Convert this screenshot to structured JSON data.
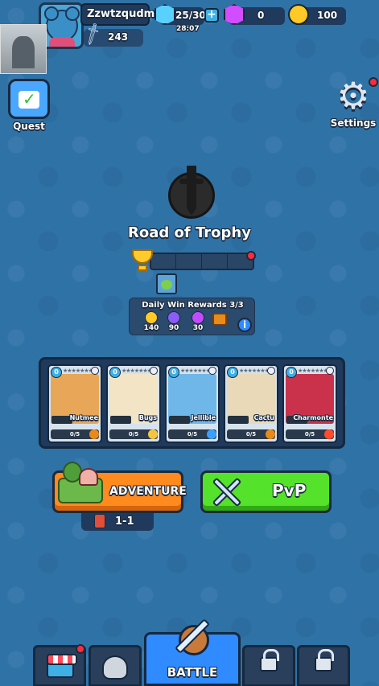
{
  "player": {
    "name": "Zzwtzqudmi",
    "power": "243"
  },
  "resources": {
    "energy": "25/30",
    "energy_timer": "28:07",
    "gems": "0",
    "coins": "100"
  },
  "side_buttons": {
    "quest_label": "Quest",
    "settings_label": "Settings"
  },
  "trophy_road": {
    "title": "Road of Trophy"
  },
  "daily_rewards": {
    "title": "Daily Win Rewards 3/3",
    "coins": "140",
    "hex": "90",
    "stars": "30"
  },
  "deck": {
    "cards": [
      {
        "name": "Nutmee",
        "level": "0",
        "progress": "0/5"
      },
      {
        "name": "Bugs",
        "level": "0",
        "progress": "0/5"
      },
      {
        "name": "Jellible",
        "level": "0",
        "progress": "0/5"
      },
      {
        "name": "Cactu",
        "level": "0",
        "progress": "0/5"
      },
      {
        "name": "Charmonte",
        "level": "0",
        "progress": "0/5"
      }
    ]
  },
  "modes": {
    "adventure_label": "ADVENTURE",
    "stage": "1-1",
    "pvp_label": "PvP"
  },
  "nav": {
    "battle_label": "BATTLE"
  },
  "colors": {
    "background": "#2f72a6",
    "adventure": "#ff8a1e",
    "pvp": "#55e22a",
    "battle_tab": "#2f8bff",
    "notification": "#ff2b3a"
  }
}
